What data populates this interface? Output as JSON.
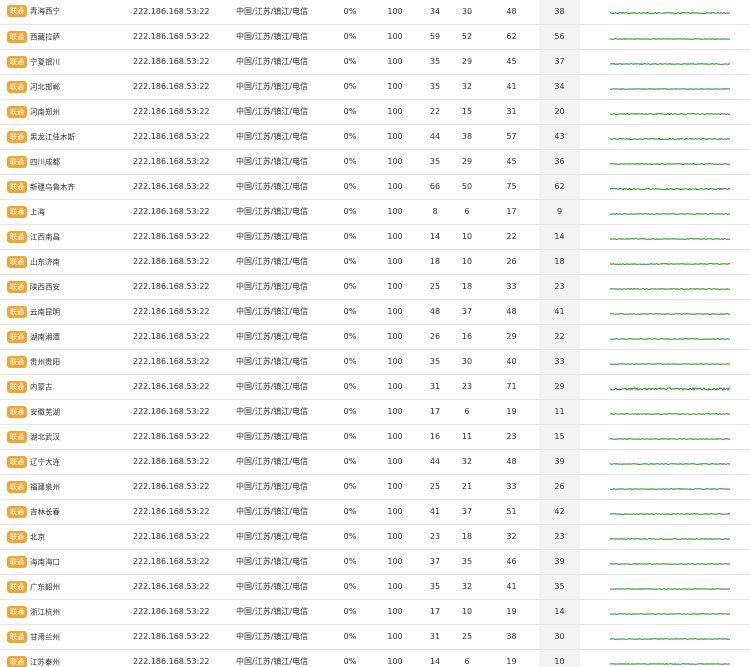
{
  "colors": {
    "badge": "#f0a636",
    "spark_line": "#2a8a2a",
    "avg_column_bg": "#f3f3f3",
    "row_border": "#e6e6e6"
  },
  "rows": [
    {
      "isp": "联通",
      "node": "青海西宁",
      "ip": "222.186.168.53:22",
      "loc": "中国/江苏/镇江/电信",
      "loss": "0%",
      "sent": "100",
      "last": "34",
      "min": "30",
      "max": "48",
      "avg": "38"
    },
    {
      "isp": "联通",
      "node": "西藏拉萨",
      "ip": "222.186.168.53:22",
      "loc": "中国/江苏/镇江/电信",
      "loss": "0%",
      "sent": "100",
      "last": "59",
      "min": "52",
      "max": "62",
      "avg": "56"
    },
    {
      "isp": "联通",
      "node": "宁夏银川",
      "ip": "222.186.168.53:22",
      "loc": "中国/江苏/镇江/电信",
      "loss": "0%",
      "sent": "100",
      "last": "35",
      "min": "29",
      "max": "45",
      "avg": "37"
    },
    {
      "isp": "联通",
      "node": "河北邯郸",
      "ip": "222.186.168.53:22",
      "loc": "中国/江苏/镇江/电信",
      "loss": "0%",
      "sent": "100",
      "last": "35",
      "min": "32",
      "max": "41",
      "avg": "34"
    },
    {
      "isp": "联通",
      "node": "河南郑州",
      "ip": "222.186.168.53:22",
      "loc": "中国/江苏/镇江/电信",
      "loss": "0%",
      "sent": "100",
      "last": "22",
      "min": "15",
      "max": "31",
      "avg": "20"
    },
    {
      "isp": "联通",
      "node": "黑龙江佳木斯",
      "ip": "222.186.168.53:22",
      "loc": "中国/江苏/镇江/电信",
      "loss": "0%",
      "sent": "100",
      "last": "44",
      "min": "38",
      "max": "57",
      "avg": "43"
    },
    {
      "isp": "联通",
      "node": "四川成都",
      "ip": "222.186.168.53:22",
      "loc": "中国/江苏/镇江/电信",
      "loss": "0%",
      "sent": "100",
      "last": "35",
      "min": "29",
      "max": "45",
      "avg": "36"
    },
    {
      "isp": "联通",
      "node": "新疆乌鲁木齐",
      "ip": "222.186.168.53:22",
      "loc": "中国/江苏/镇江/电信",
      "loss": "0%",
      "sent": "100",
      "last": "66",
      "min": "50",
      "max": "75",
      "avg": "62"
    },
    {
      "isp": "联通",
      "node": "上海",
      "ip": "222.186.168.53:22",
      "loc": "中国/江苏/镇江/电信",
      "loss": "0%",
      "sent": "100",
      "last": "8",
      "min": "6",
      "max": "17",
      "avg": "9"
    },
    {
      "isp": "联通",
      "node": "江西南昌",
      "ip": "222.186.168.53:22",
      "loc": "中国/江苏/镇江/电信",
      "loss": "0%",
      "sent": "100",
      "last": "14",
      "min": "10",
      "max": "22",
      "avg": "14"
    },
    {
      "isp": "联通",
      "node": "山东济南",
      "ip": "222.186.168.53:22",
      "loc": "中国/江苏/镇江/电信",
      "loss": "0%",
      "sent": "100",
      "last": "18",
      "min": "10",
      "max": "26",
      "avg": "18"
    },
    {
      "isp": "联通",
      "node": "陕西西安",
      "ip": "222.186.168.53:22",
      "loc": "中国/江苏/镇江/电信",
      "loss": "0%",
      "sent": "100",
      "last": "25",
      "min": "18",
      "max": "33",
      "avg": "23"
    },
    {
      "isp": "联通",
      "node": "云南昆明",
      "ip": "222.186.168.53:22",
      "loc": "中国/江苏/镇江/电信",
      "loss": "0%",
      "sent": "100",
      "last": "48",
      "min": "37",
      "max": "48",
      "avg": "41"
    },
    {
      "isp": "联通",
      "node": "湖南湘潭",
      "ip": "222.186.168.53:22",
      "loc": "中国/江苏/镇江/电信",
      "loss": "0%",
      "sent": "100",
      "last": "26",
      "min": "16",
      "max": "29",
      "avg": "22"
    },
    {
      "isp": "联通",
      "node": "贵州贵阳",
      "ip": "222.186.168.53:22",
      "loc": "中国/江苏/镇江/电信",
      "loss": "0%",
      "sent": "100",
      "last": "35",
      "min": "30",
      "max": "40",
      "avg": "33"
    },
    {
      "isp": "联通",
      "node": "内蒙古",
      "ip": "222.186.168.53:22",
      "loc": "中国/江苏/镇江/电信",
      "loss": "0%",
      "sent": "100",
      "last": "31",
      "min": "23",
      "max": "71",
      "avg": "29"
    },
    {
      "isp": "联通",
      "node": "安徽芜湖",
      "ip": "222.186.168.53:22",
      "loc": "中国/江苏/镇江/电信",
      "loss": "0%",
      "sent": "100",
      "last": "17",
      "min": "6",
      "max": "19",
      "avg": "11"
    },
    {
      "isp": "联通",
      "node": "湖北武汉",
      "ip": "222.186.168.53:22",
      "loc": "中国/江苏/镇江/电信",
      "loss": "0%",
      "sent": "100",
      "last": "16",
      "min": "11",
      "max": "23",
      "avg": "15"
    },
    {
      "isp": "联通",
      "node": "辽宁大连",
      "ip": "222.186.168.53:22",
      "loc": "中国/江苏/镇江/电信",
      "loss": "0%",
      "sent": "100",
      "last": "44",
      "min": "32",
      "max": "48",
      "avg": "39"
    },
    {
      "isp": "联通",
      "node": "福建泉州",
      "ip": "222.186.168.53:22",
      "loc": "中国/江苏/镇江/电信",
      "loss": "0%",
      "sent": "100",
      "last": "25",
      "min": "21",
      "max": "33",
      "avg": "26"
    },
    {
      "isp": "联通",
      "node": "吉林长春",
      "ip": "222.186.168.53:22",
      "loc": "中国/江苏/镇江/电信",
      "loss": "0%",
      "sent": "100",
      "last": "41",
      "min": "37",
      "max": "51",
      "avg": "42"
    },
    {
      "isp": "联通",
      "node": "北京",
      "ip": "222.186.168.53:22",
      "loc": "中国/江苏/镇江/电信",
      "loss": "0%",
      "sent": "100",
      "last": "23",
      "min": "18",
      "max": "32",
      "avg": "23"
    },
    {
      "isp": "联通",
      "node": "海南海口",
      "ip": "222.186.168.53:22",
      "loc": "中国/江苏/镇江/电信",
      "loss": "0%",
      "sent": "100",
      "last": "37",
      "min": "35",
      "max": "46",
      "avg": "39"
    },
    {
      "isp": "联通",
      "node": "广东韶州",
      "ip": "222.186.168.53:22",
      "loc": "中国/江苏/镇江/电信",
      "loss": "0%",
      "sent": "100",
      "last": "35",
      "min": "32",
      "max": "41",
      "avg": "35"
    },
    {
      "isp": "联通",
      "node": "浙江杭州",
      "ip": "222.186.168.53:22",
      "loc": "中国/江苏/镇江/电信",
      "loss": "0%",
      "sent": "100",
      "last": "17",
      "min": "10",
      "max": "19",
      "avg": "14"
    },
    {
      "isp": "联通",
      "node": "甘肃兰州",
      "ip": "222.186.168.53:22",
      "loc": "中国/江苏/镇江/电信",
      "loss": "0%",
      "sent": "100",
      "last": "31",
      "min": "25",
      "max": "38",
      "avg": "30"
    },
    {
      "isp": "联通",
      "node": "江苏泰州",
      "ip": "222.186.168.53:22",
      "loc": "中国/江苏/镇江/电信",
      "loss": "0%",
      "sent": "100",
      "last": "14",
      "min": "6",
      "max": "19",
      "avg": "10"
    }
  ]
}
